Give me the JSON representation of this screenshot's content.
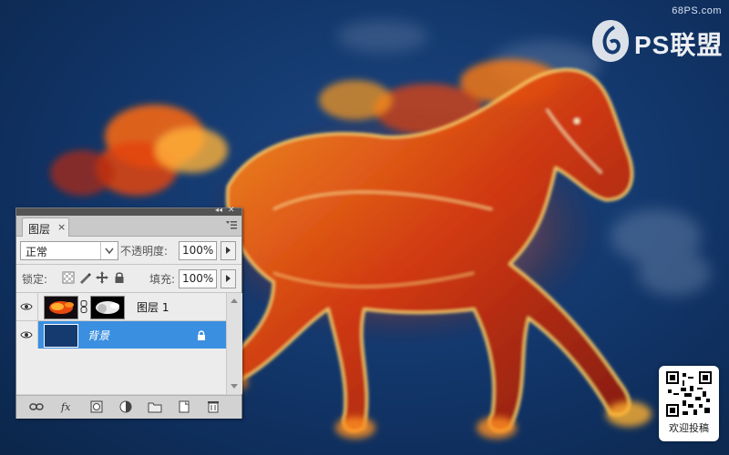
{
  "watermark": {
    "site": "68PS.com",
    "logo_text": "PS联盟"
  },
  "qr_badge": {
    "caption": "欢迎投稿"
  },
  "layers_panel": {
    "tab_label": "图层",
    "tab_close": "×",
    "blend_mode": "正常",
    "opacity_label": "不透明度:",
    "opacity_value": "100%",
    "lock_label": "锁定:",
    "fill_label": "填充:",
    "fill_value": "100%",
    "layers": [
      {
        "name": "图层 1",
        "visible": true,
        "selected": false
      },
      {
        "name": "背景",
        "visible": true,
        "selected": true,
        "locked": true
      }
    ],
    "toolbar_icons": [
      "link-layers-icon",
      "fx-icon",
      "add-mask-icon",
      "adjustment-layer-icon",
      "new-group-icon",
      "new-layer-icon",
      "delete-layer-icon"
    ]
  },
  "colors": {
    "canvas_bg": "#143a70",
    "selected_layer": "#3b8fe0",
    "fire_orange": "#ff7a10"
  }
}
